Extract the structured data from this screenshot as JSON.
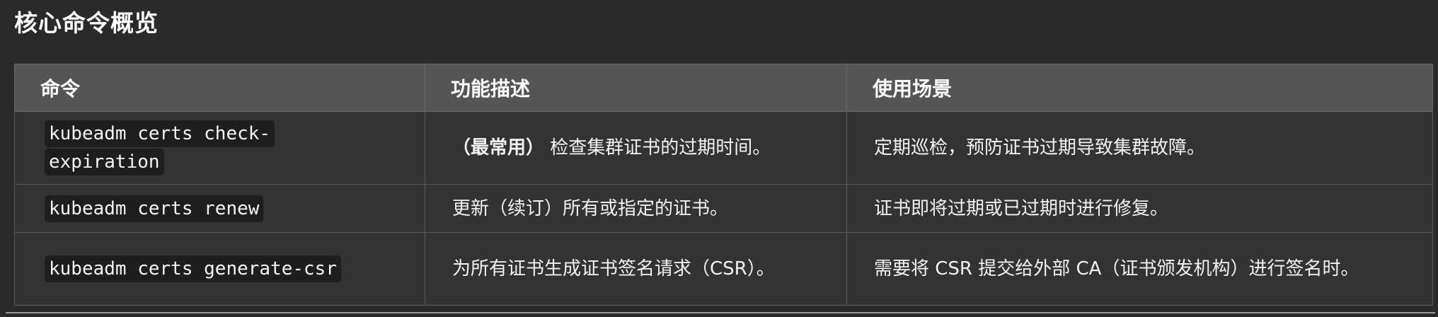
{
  "section": {
    "title": "核心命令概览"
  },
  "table": {
    "headers": {
      "command": "命令",
      "description": "功能描述",
      "usage": "使用场景"
    },
    "rows": [
      {
        "command": "kubeadm certs check-expiration",
        "description_prefix": "（最常用）",
        "description": " 检查集群证书的过期时间。",
        "usage": "定期巡检，预防证书过期导致集群故障。"
      },
      {
        "command": "kubeadm certs renew",
        "description_prefix": "",
        "description": "更新（续订）所有或指定的证书。",
        "usage": "证书即将过期或已过期时进行修复。"
      },
      {
        "command": "kubeadm certs generate-csr",
        "description_prefix": "",
        "description": "为所有证书生成证书签名请求（CSR）。",
        "usage": "需要将 CSR 提交给外部 CA（证书颁发机构）进行签名时。"
      }
    ]
  }
}
